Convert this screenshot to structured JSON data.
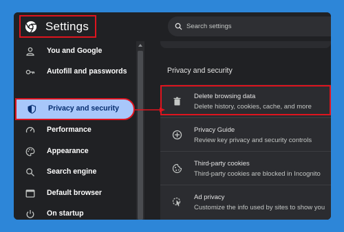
{
  "header": {
    "title": "Settings",
    "search_placeholder": "Search settings"
  },
  "sidebar": {
    "items": [
      {
        "label": "You and Google",
        "icon": "person-icon"
      },
      {
        "label": "Autofill and passwords",
        "icon": "key-icon"
      },
      {
        "label": "Privacy and security",
        "icon": "shield-icon",
        "active": true
      },
      {
        "label": "Performance",
        "icon": "speedometer-icon"
      },
      {
        "label": "Appearance",
        "icon": "palette-icon"
      },
      {
        "label": "Search engine",
        "icon": "search-icon"
      },
      {
        "label": "Default browser",
        "icon": "browser-window-icon"
      },
      {
        "label": "On startup",
        "icon": "power-icon"
      }
    ]
  },
  "main": {
    "section_title": "Privacy and security",
    "rows": [
      {
        "title": "Delete browsing data",
        "subtitle": "Delete history, cookies, cache, and more",
        "icon": "trash-icon",
        "highlighted": true
      },
      {
        "title": "Privacy Guide",
        "subtitle": "Review key privacy and security controls",
        "icon": "compass-plus-icon"
      },
      {
        "title": "Third-party cookies",
        "subtitle": "Third-party cookies are blocked in Incognito",
        "icon": "cookie-icon"
      },
      {
        "title": "Ad privacy",
        "subtitle": "Customize the info used by sites to show you",
        "icon": "ad-privacy-icon"
      }
    ]
  },
  "colors": {
    "background": "#2d86d8",
    "window": "#202124",
    "card": "#2b2c30",
    "active_nav": "#a8c7fa",
    "highlight_border": "#e0141e"
  }
}
